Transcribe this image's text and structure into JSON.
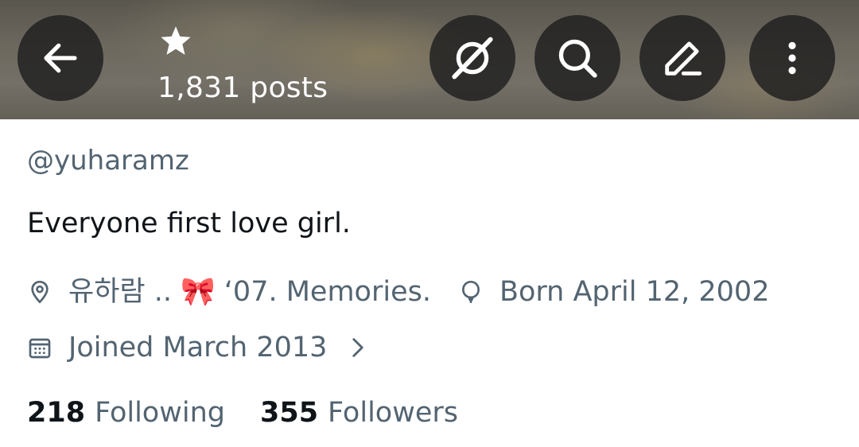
{
  "header": {
    "star_glyph": "★",
    "posts_count": "1,831 posts",
    "buttons": {
      "back": "back-arrow-icon",
      "grok": "grok-icon",
      "search": "search-icon",
      "edit": "edit-icon",
      "more": "more-vertical-icon"
    }
  },
  "profile": {
    "handle": "@yuharamz",
    "bio": "Everyone first love girl.",
    "location": "유하람 .. 🎀 ‘07. Memories.",
    "birthday": "Born April 12, 2002",
    "joined": "Joined March 2013",
    "following_count": "218",
    "following_label": "Following",
    "followers_count": "355",
    "followers_label": "Followers"
  },
  "colors": {
    "primary_text": "#0f1419",
    "secondary_text": "#536471",
    "button_bg": "#1e1e1e"
  }
}
